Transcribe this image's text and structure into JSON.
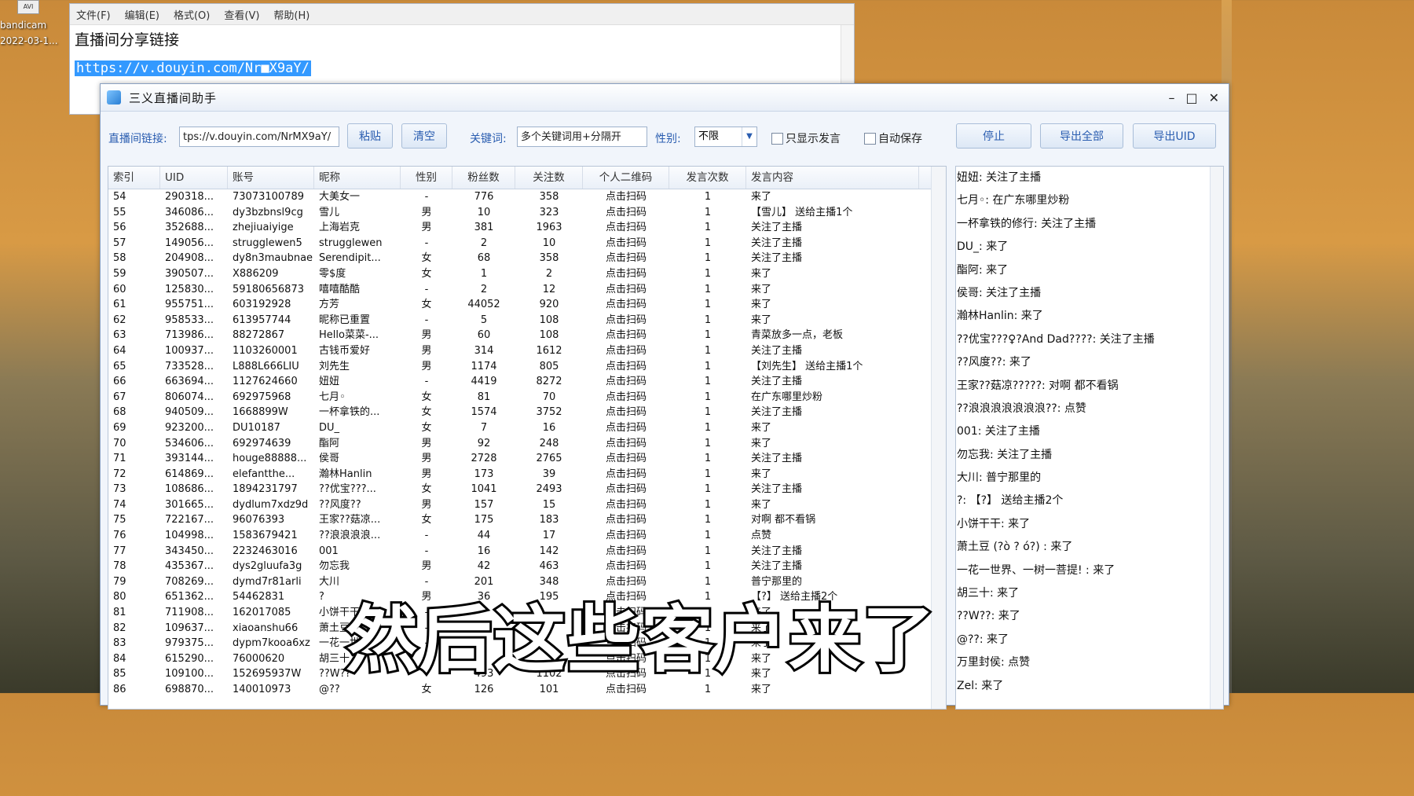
{
  "desktop": {
    "icon_badge": "AVI",
    "icon_label_1": "bandicam",
    "icon_label_2": "2022-03-1..."
  },
  "notepad": {
    "menu": [
      "文件(F)",
      "编辑(E)",
      "格式(O)",
      "查看(V)",
      "帮助(H)"
    ],
    "line1": "直播间分享链接",
    "link": "https://v.douyin.com/Nr■X9aY/"
  },
  "app": {
    "title": "三义直播间助手",
    "min": "–",
    "max": "□",
    "close": "✕",
    "link_label": "直播间链接:",
    "link_value": "tps://v.douyin.com/NrMX9aY/",
    "paste": "粘贴",
    "clear": "清空",
    "keyword_label": "关键词:",
    "keyword_value": "多个关键词用+分隔开",
    "gender_label": "性别:",
    "gender_value": "不限",
    "only_speech": "只显示发言",
    "auto_save": "自动保存",
    "stop": "停止",
    "export_all": "导出全部",
    "export_uid": "导出UID"
  },
  "table": {
    "headers": [
      "索引",
      "UID",
      "账号",
      "昵称",
      "性别",
      "粉丝数",
      "关注数",
      "个人二维码",
      "发言次数",
      "发言内容"
    ],
    "rows": [
      [
        "54",
        "290318...",
        "73073100789",
        "大美女一",
        "-",
        "776",
        "358",
        "点击扫码",
        "1",
        "来了"
      ],
      [
        "55",
        "346086...",
        "dy3bzbnsl9cg",
        "雪儿",
        "男",
        "10",
        "323",
        "点击扫码",
        "1",
        "【雪儿】 送给主播1个"
      ],
      [
        "56",
        "352688...",
        "zhejiuaiyige",
        "上海岩克",
        "男",
        "381",
        "1963",
        "点击扫码",
        "1",
        "关注了主播"
      ],
      [
        "57",
        "149056...",
        "strugglewen5",
        "strugglewen",
        "-",
        "2",
        "10",
        "点击扫码",
        "1",
        "关注了主播"
      ],
      [
        "58",
        "204908...",
        "dy8n3maubnae",
        "Serendipit...",
        "女",
        "68",
        "358",
        "点击扫码",
        "1",
        "关注了主播"
      ],
      [
        "59",
        "390507...",
        "X886209",
        "零$度",
        "女",
        "1",
        "2",
        "点击扫码",
        "1",
        "来了"
      ],
      [
        "60",
        "125830...",
        "59180656873",
        "嘻嘻酷酷",
        "-",
        "2",
        "12",
        "点击扫码",
        "1",
        "来了"
      ],
      [
        "61",
        "955751...",
        "603192928",
        "方芳",
        "女",
        "44052",
        "920",
        "点击扫码",
        "1",
        "来了"
      ],
      [
        "62",
        "958533...",
        "613957744",
        "昵称已重置",
        "-",
        "5",
        "108",
        "点击扫码",
        "1",
        "来了"
      ],
      [
        "63",
        "713986...",
        "88272867",
        "Hello菜菜-...",
        "男",
        "60",
        "108",
        "点击扫码",
        "1",
        "青菜放多一点，老板"
      ],
      [
        "64",
        "100937...",
        "1103260001",
        "古钱币爱好",
        "男",
        "314",
        "1612",
        "点击扫码",
        "1",
        "关注了主播"
      ],
      [
        "65",
        "733528...",
        "L888L666LIU",
        "刘先生",
        "男",
        "1174",
        "805",
        "点击扫码",
        "1",
        "【刘先生】 送给主播1个"
      ],
      [
        "66",
        "663694...",
        "1127624660",
        "妞妞",
        "-",
        "4419",
        "8272",
        "点击扫码",
        "1",
        "关注了主播"
      ],
      [
        "67",
        "806074...",
        "692975968",
        "七月◦",
        "女",
        "81",
        "70",
        "点击扫码",
        "1",
        "在广东哪里炒粉"
      ],
      [
        "68",
        "940509...",
        "1668899W",
        "一杯拿铁的...",
        "女",
        "1574",
        "3752",
        "点击扫码",
        "1",
        "关注了主播"
      ],
      [
        "69",
        "923200...",
        "DU10187",
        "DU_",
        "女",
        "7",
        "16",
        "点击扫码",
        "1",
        "来了"
      ],
      [
        "70",
        "534606...",
        "692974639",
        "酯阿",
        "男",
        "92",
        "248",
        "点击扫码",
        "1",
        "来了"
      ],
      [
        "71",
        "393144...",
        "houge88888...",
        "侯哥",
        "男",
        "2728",
        "2765",
        "点击扫码",
        "1",
        "关注了主播"
      ],
      [
        "72",
        "614869...",
        "elefantthe...",
        "瀚林Hanlin",
        "男",
        "173",
        "39",
        "点击扫码",
        "1",
        "来了"
      ],
      [
        "73",
        "108686...",
        "1894231797",
        "??优宝???...",
        "女",
        "1041",
        "2493",
        "点击扫码",
        "1",
        "关注了主播"
      ],
      [
        "74",
        "301665...",
        "dydlum7xdz9d",
        "??风度??",
        "男",
        "157",
        "15",
        "点击扫码",
        "1",
        "来了"
      ],
      [
        "75",
        "722167...",
        "96076393",
        "王家??菇凉...",
        "女",
        "175",
        "183",
        "点击扫码",
        "1",
        "对啊 都不看锅"
      ],
      [
        "76",
        "104998...",
        "1583679421",
        "??浪浪浪浪...",
        "-",
        "44",
        "17",
        "点击扫码",
        "1",
        "点赞"
      ],
      [
        "77",
        "343450...",
        "2232463016",
        "001",
        "-",
        "16",
        "142",
        "点击扫码",
        "1",
        "关注了主播"
      ],
      [
        "78",
        "435367...",
        "dys2gluufa3g",
        "勿忘我",
        "男",
        "42",
        "463",
        "点击扫码",
        "1",
        "关注了主播"
      ],
      [
        "79",
        "708269...",
        "dymd7r81arli",
        "大川",
        "-",
        "201",
        "348",
        "点击扫码",
        "1",
        "普宁那里的"
      ],
      [
        "80",
        "651362...",
        "54462831",
        "?",
        "男",
        "36",
        "195",
        "点击扫码",
        "1",
        "【?】 送给主播2个"
      ],
      [
        "81",
        "711908...",
        "162017085",
        "小饼干干",
        "-",
        "",
        "",
        "点击扫码",
        "1",
        "来了"
      ],
      [
        "82",
        "109637...",
        "xiaoanshu66",
        "萧土豆",
        "-",
        "",
        "",
        "点击扫码",
        "1",
        "来了"
      ],
      [
        "83",
        "979375...",
        "dypm7kooa6xz",
        "一花一世界",
        "-",
        "7",
        "",
        "点击扫码",
        "1",
        "来了"
      ],
      [
        "84",
        "615290...",
        "76000620",
        "胡三十",
        "-",
        "",
        "",
        "点击扫码",
        "1",
        "来了"
      ],
      [
        "85",
        "109100...",
        "152695937W",
        "??W??",
        "-",
        "493",
        "1102",
        "点击扫码",
        "1",
        "来了"
      ],
      [
        "86",
        "698870...",
        "140010973",
        "@??",
        "女",
        "126",
        "101",
        "点击扫码",
        "1",
        "来了"
      ]
    ]
  },
  "messages": [
    "妞妞: 关注了主播",
    "七月◦: 在广东哪里炒粉",
    "一杯拿铁的修行: 关注了主播",
    "DU_: 来了",
    "酯阿: 来了",
    "侯哥: 关注了主播",
    "瀚林Hanlin: 来了",
    "??优宝???♀?And Dad????: 关注了主播",
    "??风度??: 来了",
    "王家??菇凉?????: 对啊 都不看锅",
    "??浪浪浪浪浪浪浪??: 点赞",
    "001: 关注了主播",
    "勿忘我: 关注了主播",
    "大川: 普宁那里的",
    "?: 【?】 送给主播2个",
    "小饼干干: 来了",
    "萧土豆 (?ò ? ó?) : 来了",
    "一花一世界、一树一菩提! : 来了",
    "胡三十: 来了",
    "??W??: 来了",
    "@??: 来了",
    "万里封侯: 点赞",
    "Zel: 来了"
  ],
  "caption": "然后这些客户来了"
}
